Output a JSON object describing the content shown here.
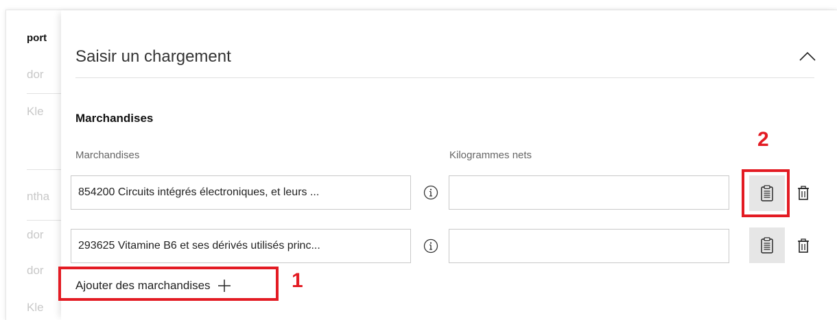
{
  "background": {
    "items": [
      {
        "text": "port",
        "style": "dark"
      },
      {
        "text": "dor",
        "style": "faded"
      },
      {
        "text": "Kle",
        "style": "faded"
      },
      {
        "text": "ntha",
        "style": "faded"
      },
      {
        "text": "dor",
        "style": "faded"
      },
      {
        "text": "dor",
        "style": "faded"
      },
      {
        "text": "Kle",
        "style": "faded"
      }
    ]
  },
  "panel": {
    "title": "Saisir un chargement",
    "collapse_icon": "chevron-up-icon",
    "section_title": "Marchandises",
    "label_goods": "Marchandises",
    "label_weight": "Kilogrammes nets",
    "rows": [
      {
        "goods": "854200 Circuits intégrés électroniques, et leurs ...",
        "weight": ""
      },
      {
        "goods": "293625 Vitamine B6 et ses dérivés utilisés princ...",
        "weight": ""
      }
    ],
    "add_label": "Ajouter des marchandises"
  },
  "annotations": {
    "marker_1": "1",
    "marker_2": "2",
    "color": "#e31b23"
  },
  "colors": {
    "button_bg": "#e6e6e6",
    "border": "#c8c8c8"
  }
}
